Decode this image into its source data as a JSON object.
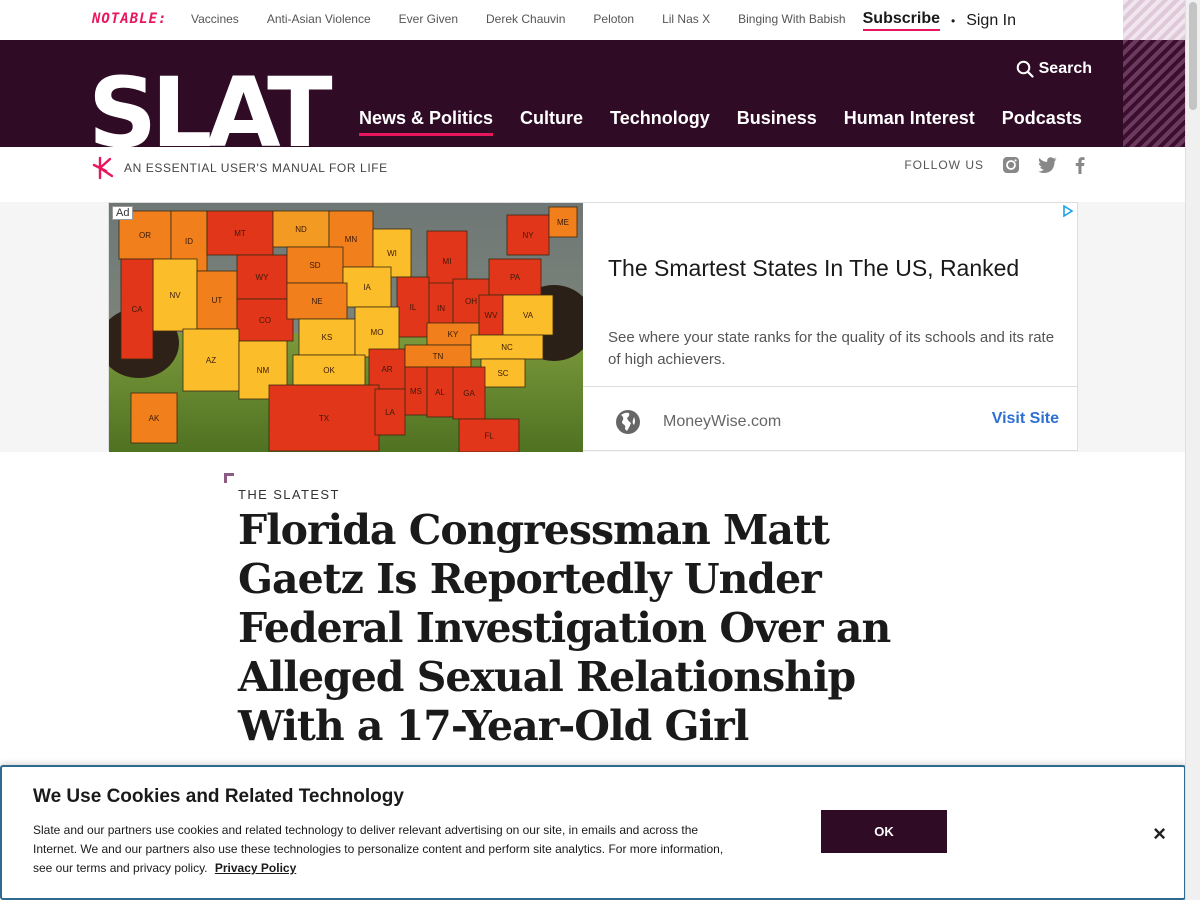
{
  "notable": {
    "label": "NOTABLE:",
    "links": [
      "Vaccines",
      "Anti-Asian Violence",
      "Ever Given",
      "Derek Chauvin",
      "Peloton",
      "Lil Nas X",
      "Binging With Babish"
    ]
  },
  "account": {
    "subscribe": "Subscribe",
    "separator": "•",
    "sign_in": "Sign In"
  },
  "header": {
    "logo": "SLATE",
    "search": "Search",
    "nav": [
      "News & Politics",
      "Culture",
      "Technology",
      "Business",
      "Human Interest",
      "Podcasts"
    ],
    "active_nav": "News & Politics"
  },
  "tagline": "AN ESSENTIAL USER'S MANUAL FOR LIFE",
  "follow": {
    "label": "FOLLOW US",
    "icons": [
      "instagram-icon",
      "twitter-icon",
      "facebook-icon"
    ]
  },
  "ad": {
    "label": "Ad",
    "title": "The Smartest States In The US, Ranked",
    "description": "See where your state ranks for the quality of its schools and its rate of high achievers.",
    "source": "MoneyWise.com",
    "cta": "Visit Site",
    "map_states": [
      {
        "abbr": "OR"
      },
      {
        "abbr": "ID"
      },
      {
        "abbr": "MT"
      },
      {
        "abbr": "ND"
      },
      {
        "abbr": "MN"
      },
      {
        "abbr": "WI"
      },
      {
        "abbr": "MI"
      },
      {
        "abbr": "NY"
      },
      {
        "abbr": "ME"
      },
      {
        "abbr": "NV"
      },
      {
        "abbr": "UT"
      },
      {
        "abbr": "WY"
      },
      {
        "abbr": "SD"
      },
      {
        "abbr": "IA"
      },
      {
        "abbr": "IL"
      },
      {
        "abbr": "IN"
      },
      {
        "abbr": "OH"
      },
      {
        "abbr": "PA"
      },
      {
        "abbr": "CA"
      },
      {
        "abbr": "CO"
      },
      {
        "abbr": "NE"
      },
      {
        "abbr": "KS"
      },
      {
        "abbr": "MO"
      },
      {
        "abbr": "KY"
      },
      {
        "abbr": "WV"
      },
      {
        "abbr": "VA"
      },
      {
        "abbr": "AZ"
      },
      {
        "abbr": "NM"
      },
      {
        "abbr": "OK"
      },
      {
        "abbr": "AR"
      },
      {
        "abbr": "TN"
      },
      {
        "abbr": "NC"
      },
      {
        "abbr": "SC"
      },
      {
        "abbr": "TX"
      },
      {
        "abbr": "MS"
      },
      {
        "abbr": "AL"
      },
      {
        "abbr": "GA"
      },
      {
        "abbr": "LA"
      },
      {
        "abbr": "FL"
      },
      {
        "abbr": "AK"
      }
    ]
  },
  "article": {
    "kicker": "THE SLATEST",
    "headline": "Florida Congressman Matt Gaetz Is Reportedly Under Federal Investigation Over an Alleged Sexual Relationship With a 17-Year-Old Girl"
  },
  "cookie": {
    "title": "We Use Cookies and Related Technology",
    "body": "Slate and our partners use cookies and related technology to deliver relevant advertising on our site, in emails and across the Internet. We and our partners also use these technologies to personalize content and perform site analytics. For more information, see our terms and privacy policy.",
    "privacy_link": "Privacy Policy",
    "ok": "OK",
    "close": "×"
  },
  "colors": {
    "brand_dark": "#2f0b26",
    "accent_pink": "#e8175d",
    "link_blue": "#2d6fcf"
  }
}
